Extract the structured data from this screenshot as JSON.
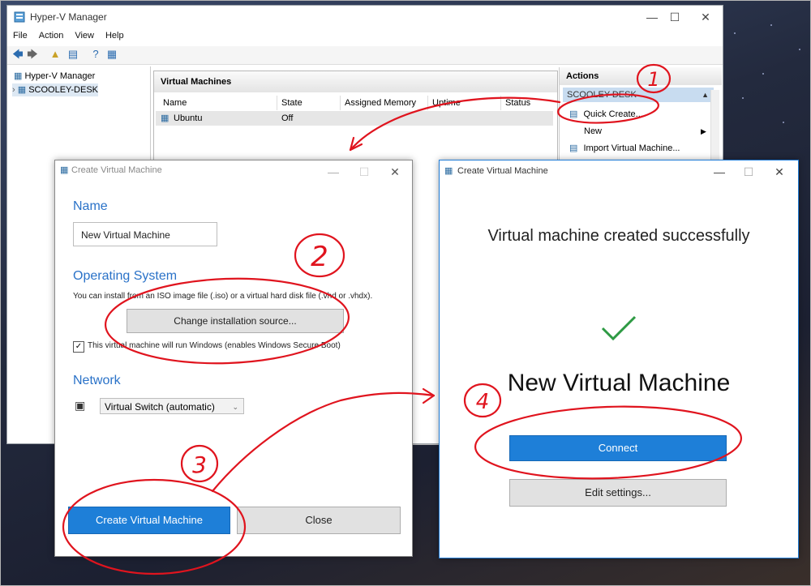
{
  "main_window": {
    "title": "Hyper-V Manager",
    "menu": [
      "File",
      "Action",
      "View",
      "Help"
    ],
    "tree": {
      "root": "Hyper-V Manager",
      "host": "SCOOLEY-DESK"
    },
    "vm_panel": {
      "title": "Virtual Machines",
      "columns": [
        "Name",
        "State",
        "Assigned Memory",
        "Uptime",
        "Status"
      ],
      "rows": [
        {
          "name": "Ubuntu",
          "state": "Off"
        }
      ]
    },
    "actions": {
      "title": "Actions",
      "host": "SCOOLEY-DESK",
      "items": [
        "Quick Create...",
        "New",
        "Import Virtual Machine..."
      ]
    }
  },
  "create_dialog": {
    "title": "Create Virtual Machine",
    "name_section": "Name",
    "name_value": "New Virtual Machine",
    "os_section": "Operating System",
    "os_description": "You can install from an ISO image file (.iso) or a virtual hard disk file (.vhd or .vhdx).",
    "change_source_button": "Change installation source...",
    "windows_checkbox_label": "This virtual machine will run Windows (enables Windows Secure Boot)",
    "windows_checked": true,
    "network_section": "Network",
    "network_value": "Virtual Switch (automatic)",
    "create_button": "Create Virtual Machine",
    "close_button": "Close"
  },
  "success_dialog": {
    "title": "Create Virtual Machine",
    "message": "Virtual machine created successfully",
    "vm_name": "New Virtual Machine",
    "connect_button": "Connect",
    "edit_settings_button": "Edit settings..."
  },
  "annotations": [
    "1",
    "2",
    "3",
    "4"
  ],
  "colors": {
    "accent_blue": "#1e7fd8",
    "annotation_red": "#e0141e",
    "success_green": "#2e9a44",
    "section_blue": "#2a72c8"
  }
}
